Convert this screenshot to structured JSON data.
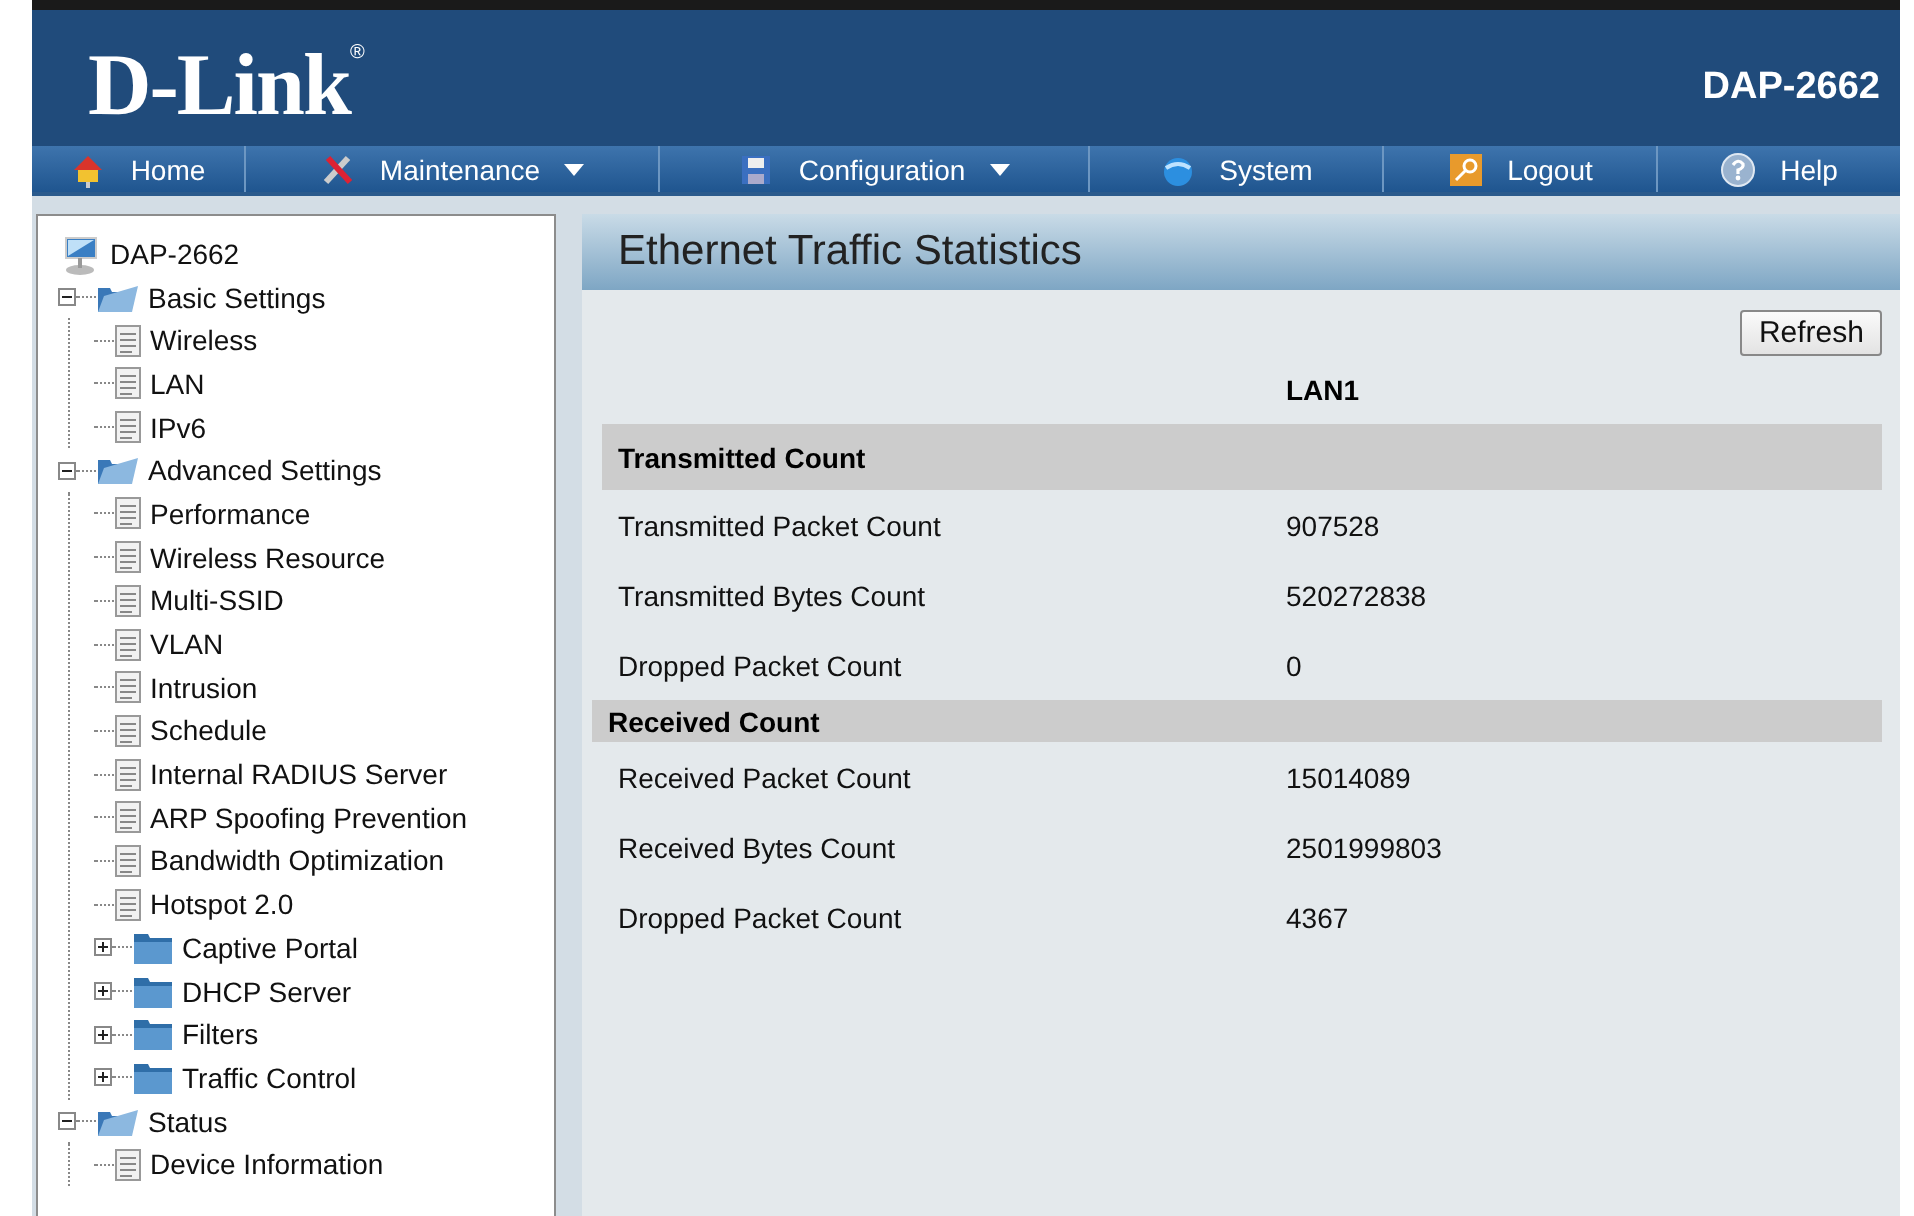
{
  "header": {
    "logo": "D-Link",
    "logo_mark": "®",
    "model": "DAP-2662"
  },
  "nav": [
    {
      "label": "Home",
      "dropdown": false
    },
    {
      "label": "Maintenance",
      "dropdown": true
    },
    {
      "label": "Configuration",
      "dropdown": true
    },
    {
      "label": "System",
      "dropdown": false
    },
    {
      "label": "Logout",
      "dropdown": false
    },
    {
      "label": "Help",
      "dropdown": false
    }
  ],
  "tree": [
    {
      "kind": "device",
      "label": "DAP-2662"
    },
    {
      "kind": "folder",
      "label": "Basic Settings",
      "expanded": true,
      "children": [
        {
          "kind": "page",
          "label": "Wireless"
        },
        {
          "kind": "page",
          "label": "LAN"
        },
        {
          "kind": "page",
          "label": "IPv6"
        }
      ]
    },
    {
      "kind": "folder",
      "label": "Advanced Settings",
      "expanded": true,
      "children": [
        {
          "kind": "page",
          "label": "Performance"
        },
        {
          "kind": "page",
          "label": "Wireless Resource"
        },
        {
          "kind": "page",
          "label": "Multi-SSID"
        },
        {
          "kind": "page",
          "label": "VLAN"
        },
        {
          "kind": "page",
          "label": "Intrusion"
        },
        {
          "kind": "page",
          "label": "Schedule"
        },
        {
          "kind": "page",
          "label": "Internal RADIUS Server"
        },
        {
          "kind": "page",
          "label": "ARP Spoofing Prevention"
        },
        {
          "kind": "page",
          "label": "Bandwidth Optimization"
        },
        {
          "kind": "page",
          "label": "Hotspot 2.0"
        },
        {
          "kind": "folder",
          "label": "Captive Portal",
          "expanded": false
        },
        {
          "kind": "folder",
          "label": "DHCP Server",
          "expanded": false
        },
        {
          "kind": "folder",
          "label": "Filters",
          "expanded": false
        },
        {
          "kind": "folder",
          "label": "Traffic Control",
          "expanded": false
        }
      ]
    },
    {
      "kind": "folder",
      "label": "Status",
      "expanded": true,
      "children": [
        {
          "kind": "page",
          "label": "Device Information"
        }
      ]
    }
  ],
  "panel": {
    "title": "Ethernet Traffic Statistics",
    "refresh_button": "Refresh",
    "column_header": "LAN1",
    "sections": [
      {
        "title": "Transmitted Count",
        "rows": [
          {
            "label": "Transmitted Packet Count",
            "value": "907528"
          },
          {
            "label": "Transmitted Bytes Count",
            "value": "520272838"
          },
          {
            "label": "Dropped Packet Count",
            "value": "0"
          }
        ]
      },
      {
        "title": "Received Count",
        "rows": [
          {
            "label": "Received Packet Count",
            "value": "15014089"
          },
          {
            "label": "Received Bytes Count",
            "value": "2501999803"
          },
          {
            "label": "Dropped Packet Count",
            "value": "4367"
          }
        ]
      }
    ]
  }
}
